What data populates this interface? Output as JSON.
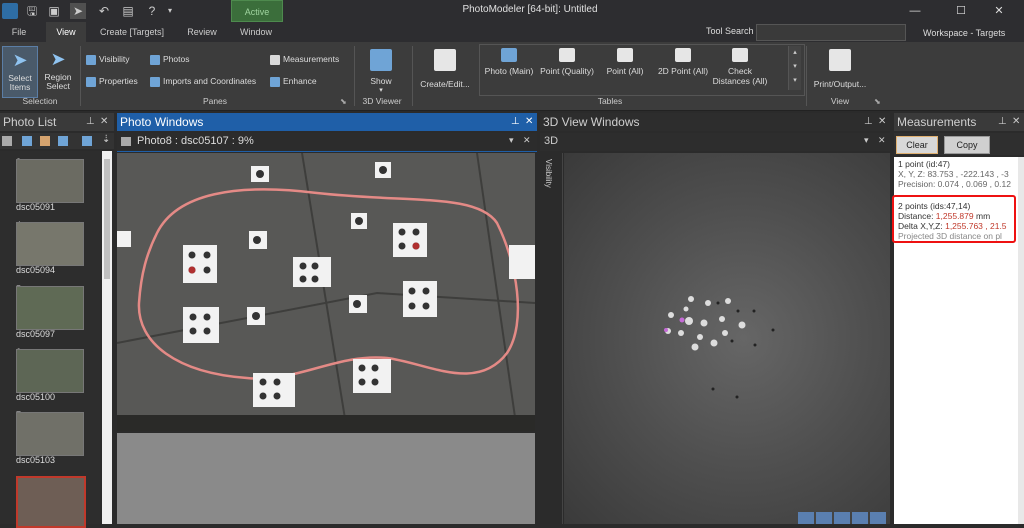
{
  "app": {
    "title": "PhotoModeler [64-bit]: Untitled",
    "active_label": "Active"
  },
  "menu": {
    "tabs": [
      "File",
      "View",
      "Create  [Targets]",
      "Review",
      "Window"
    ],
    "tool_search_label": "Tool Search",
    "workspace_label": "Workspace - Targets"
  },
  "ribbon": {
    "select_items": "Select Items",
    "region_select": "Region Select",
    "selection_group": "Selection",
    "visibility": "Visibility",
    "properties": "Properties",
    "photos": "Photos",
    "imports_coords": "Imports and Coordinates",
    "measurements": "Measurements",
    "enhance": "Enhance",
    "panes_group": "Panes",
    "show": "Show",
    "viewer3d_group": "3D Viewer",
    "create_edit": "Create/Edit...",
    "tables": [
      "Photo (Main)",
      "Point (Quality)",
      "Point (All)",
      "2D Point (All)",
      "Check Distances (All)"
    ],
    "tables_group": "Tables",
    "print_output": "Print/Output...",
    "view_group": "View"
  },
  "photo_list": {
    "title": "Photo List",
    "items": [
      {
        "num": "3",
        "name": "dsc05091"
      },
      {
        "num": "4",
        "name": "dsc05094"
      },
      {
        "num": "5",
        "name": "dsc05097"
      },
      {
        "num": "6",
        "name": "dsc05100"
      },
      {
        "num": "7",
        "name": "dsc05103"
      }
    ]
  },
  "photo_windows": {
    "title": "Photo Windows",
    "tab": "Photo8 : dsc05107 : 9%"
  },
  "view3d": {
    "title": "3D View Windows",
    "tab": "3D",
    "side_tab": "Visibility"
  },
  "measurements": {
    "title": "Measurements",
    "clear": "Clear",
    "copy": "Copy",
    "block1": {
      "header": "1 point (id:47)",
      "line1": "X, Y, Z: 83.753 , -222.143 , -3",
      "line2": "Precision: 0.074 , 0.069 , 0.12"
    },
    "block2": {
      "header": "2 points (ids:47,14)",
      "distance_label": "Distance: ",
      "distance_value": "1,255.879",
      "distance_unit": " mm",
      "delta_label": "Delta X,Y,Z: ",
      "delta_value": "1,255.763 , 21.5",
      "projected": "Projected 3D distance on pl"
    }
  }
}
